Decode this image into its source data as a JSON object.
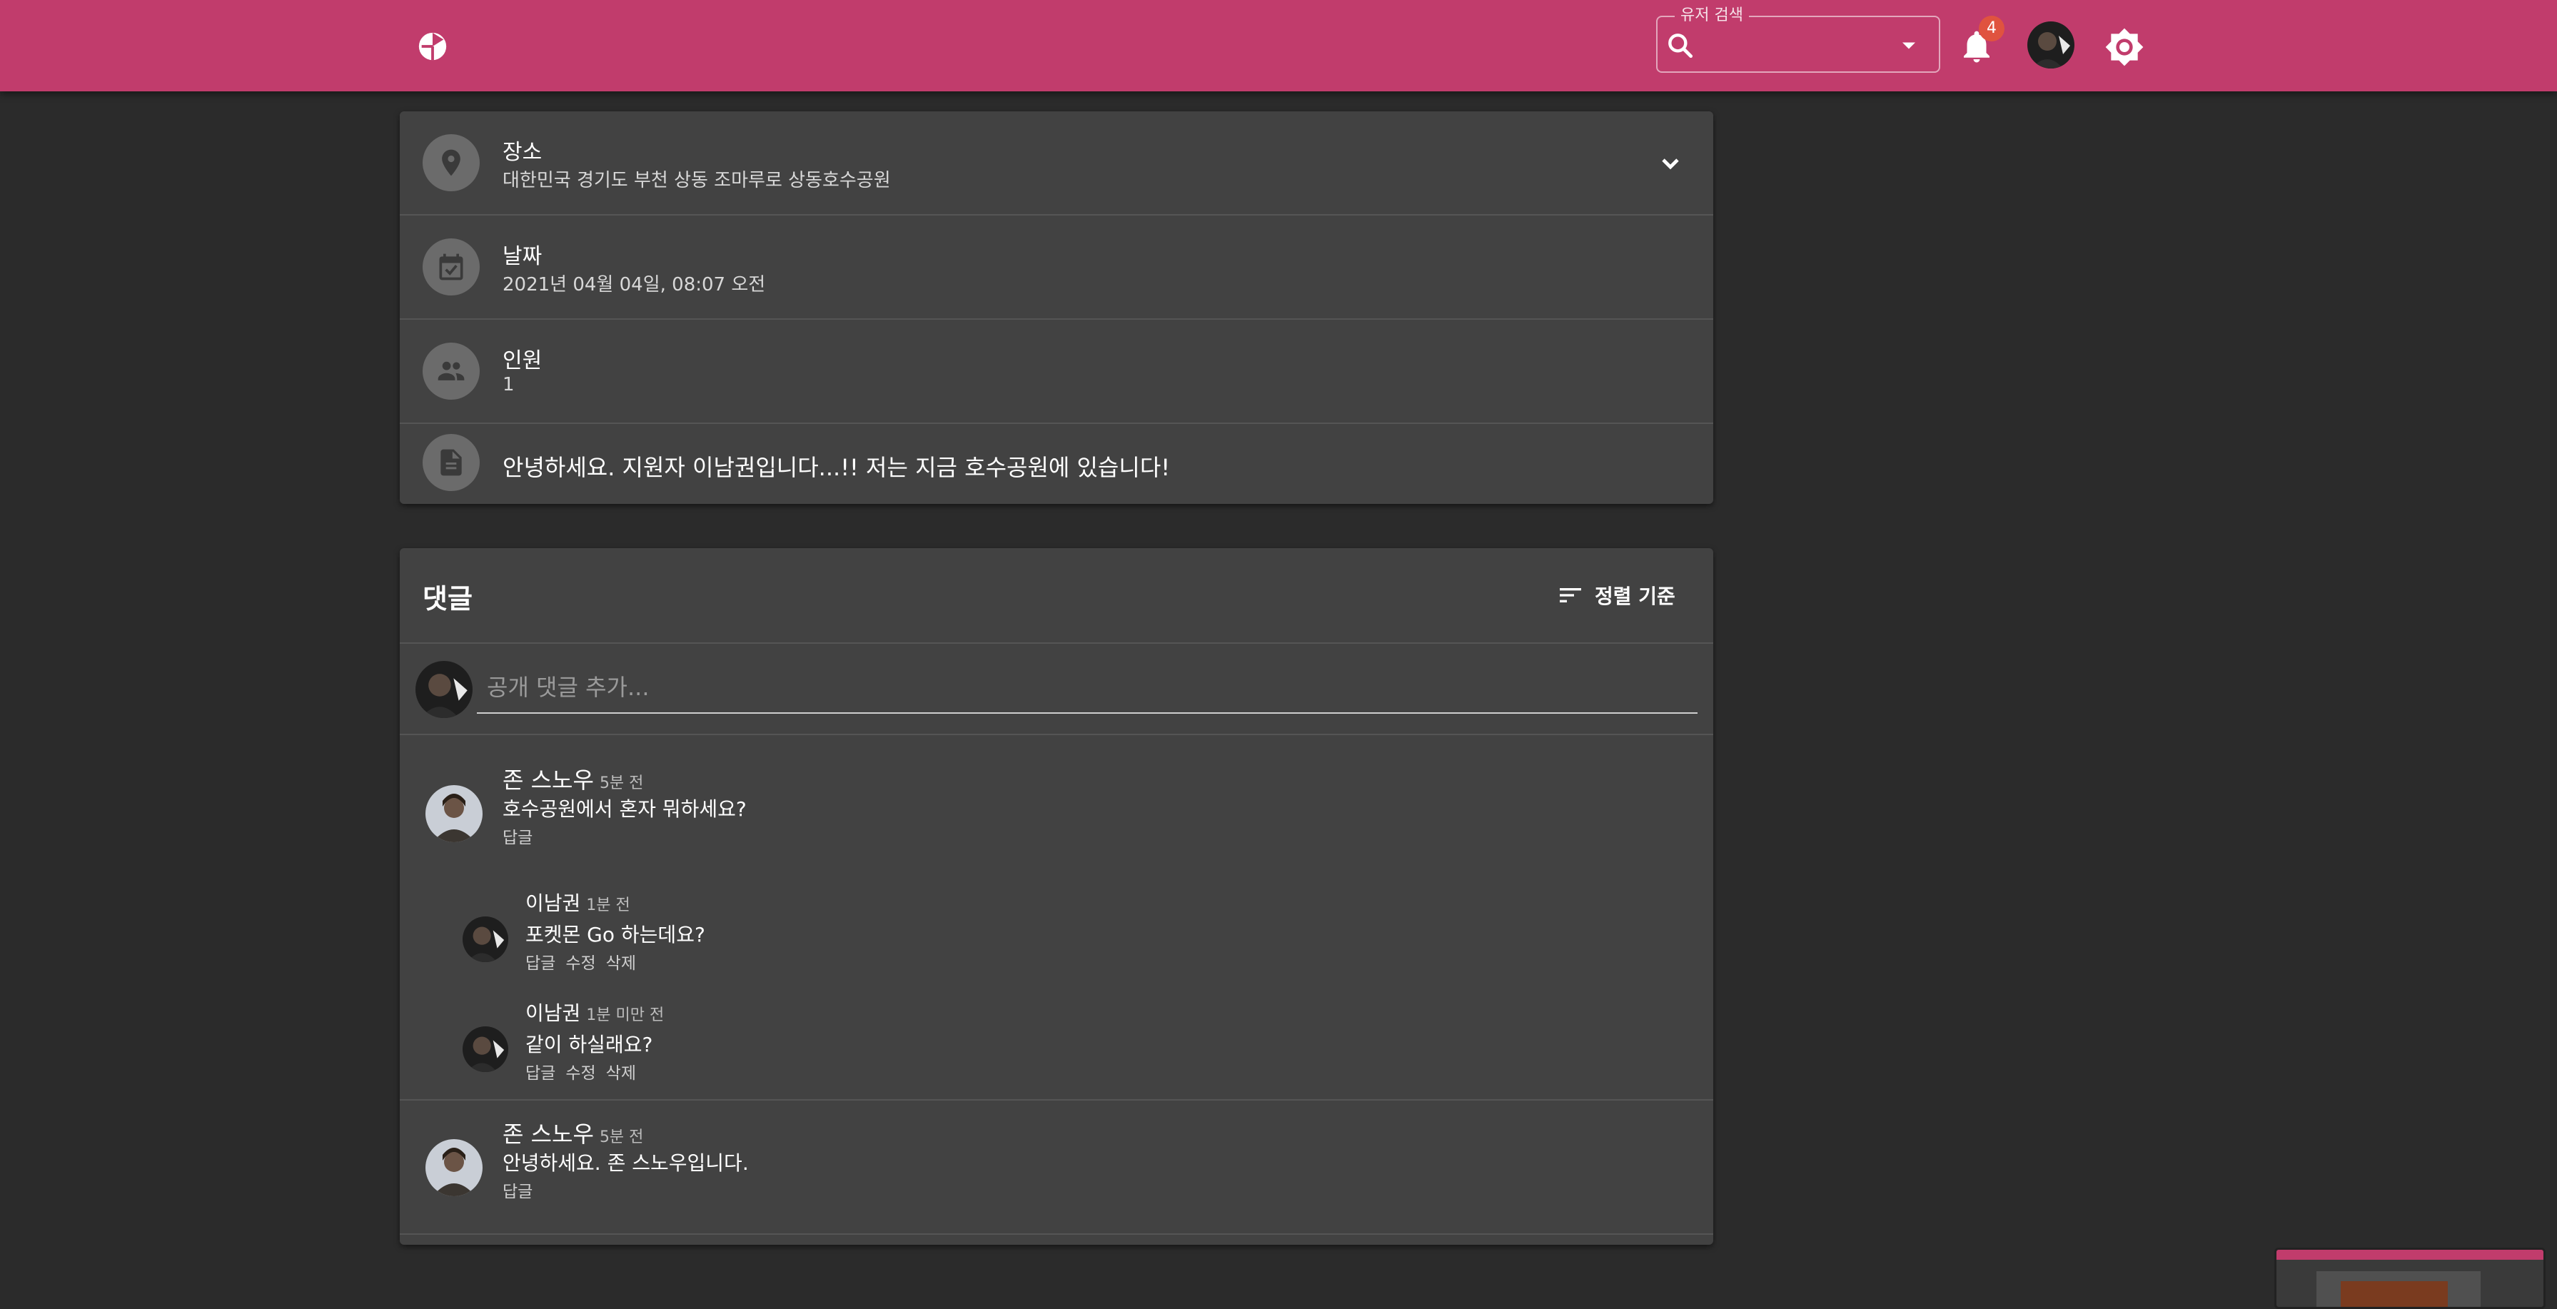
{
  "header": {
    "search": {
      "label": "유저 검색",
      "value": ""
    },
    "notifications": {
      "count": "4"
    }
  },
  "post": {
    "place": {
      "label": "장소",
      "value": "대한민국 경기도 부천 상동 조마루로 상동호수공원"
    },
    "date": {
      "label": "날짜",
      "value": "2021년 04월 04일, 08:07 오전"
    },
    "people": {
      "label": "인원",
      "value": "1"
    },
    "description": "안녕하세요. 지원자 이남권입니다...!! 저는 지금 호수공원에 있습니다!"
  },
  "comments": {
    "title": "댓글",
    "sort_label": "정렬 기준",
    "new_comment_placeholder": "공개 댓글 추가...",
    "reply_label": "답글",
    "edit_label": "수정",
    "delete_label": "삭제",
    "threads": [
      {
        "author": "존 스노우",
        "time": "5분 전",
        "text": "호수공원에서 혼자 뭐하세요?",
        "replies": [
          {
            "author": "이남권",
            "time": "1분 전",
            "text": "포켓몬 Go 하는데요?"
          },
          {
            "author": "이남권",
            "time": "1분 미만 전",
            "text": "같이 하실래요?"
          }
        ]
      },
      {
        "author": "존 스노우",
        "time": "5분 전",
        "text": "안녕하세요. 존 스노우입니다.",
        "replies": []
      }
    ]
  },
  "colors": {
    "appbar": "#c13c6c",
    "background": "#2b2b2b",
    "card": "#424242",
    "badge": "#e0533f"
  },
  "icons": [
    "logo-icon",
    "search-icon",
    "dropdown-arrow-icon",
    "bell-icon",
    "avatar",
    "brightness-icon",
    "location-pin-icon",
    "calendar-check-icon",
    "people-icon",
    "document-icon",
    "chevron-down-icon",
    "sort-icon"
  ]
}
